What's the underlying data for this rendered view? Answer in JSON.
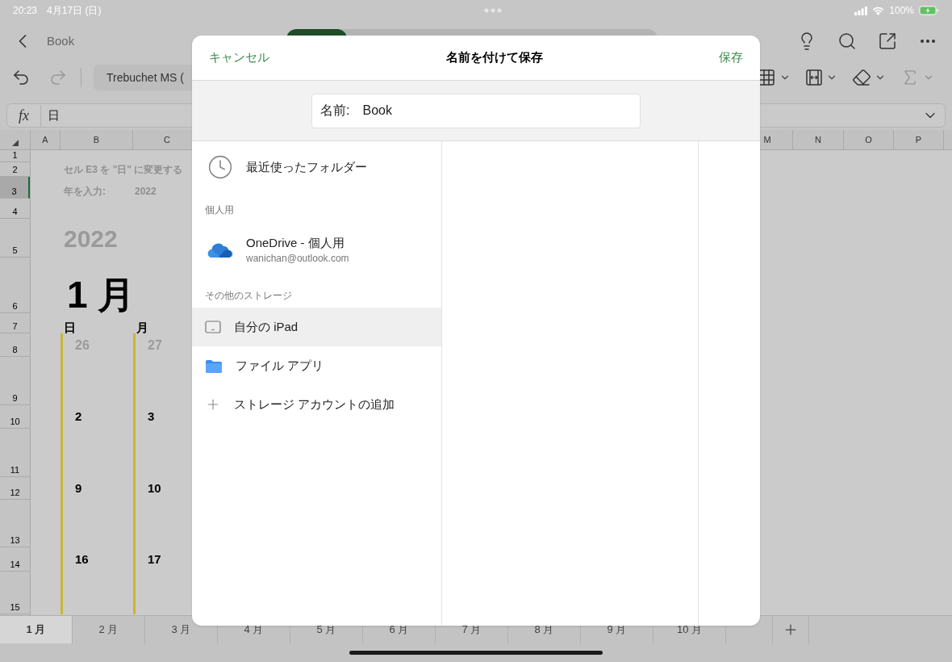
{
  "status_bar": {
    "time": "20:23",
    "date": "4月17日 (日)",
    "battery": "100%"
  },
  "title_bar": {
    "title": "Book"
  },
  "toolbar": {
    "font": "Trebuchet MS ("
  },
  "formula_bar": {
    "function_label": "fx",
    "value": "日"
  },
  "sheet": {
    "columns_left": [
      "A",
      "B",
      "C"
    ],
    "columns_right": [
      "M",
      "N",
      "O",
      "P"
    ],
    "rows": [
      {
        "number": "1",
        "selected": false,
        "cells": []
      },
      {
        "number": "2",
        "selected": false,
        "cells": [
          {
            "text": "セル E3 を \"日\" に変更する",
            "kind": "note"
          }
        ]
      },
      {
        "number": "3",
        "selected": true,
        "cells": [
          {
            "text": "年を入力:",
            "kind": "note"
          },
          {
            "text": "2022",
            "kind": "input"
          }
        ]
      },
      {
        "number": "4",
        "selected": false,
        "cells": []
      },
      {
        "number": "5",
        "selected": false,
        "cells": [
          {
            "text": "2022",
            "kind": "year"
          }
        ]
      },
      {
        "number": "6",
        "selected": false,
        "cells": [
          {
            "text": "1 月",
            "kind": "month"
          }
        ]
      },
      {
        "number": "7",
        "selected": false,
        "cells": [
          {
            "text": "日",
            "kind": "weekday"
          },
          {
            "text": "月",
            "kind": "weekday"
          }
        ]
      },
      {
        "number": "8",
        "selected": false,
        "cells": [
          {
            "text": "26",
            "kind": "other_month"
          },
          {
            "text": "27",
            "kind": "other_month"
          }
        ]
      },
      {
        "number": "9",
        "selected": false,
        "cells": []
      },
      {
        "number": "10",
        "selected": false,
        "cells": [
          {
            "text": "2",
            "kind": "date"
          },
          {
            "text": "3",
            "kind": "date"
          }
        ]
      },
      {
        "number": "11",
        "selected": false,
        "cells": []
      },
      {
        "number": "12",
        "selected": false,
        "cells": [
          {
            "text": "9",
            "kind": "date"
          },
          {
            "text": "10",
            "kind": "date"
          }
        ]
      },
      {
        "number": "13",
        "selected": false,
        "cells": []
      },
      {
        "number": "14",
        "selected": false,
        "cells": [
          {
            "text": "16",
            "kind": "date"
          },
          {
            "text": "17",
            "kind": "date"
          }
        ]
      },
      {
        "number": "15",
        "selected": false,
        "cells": []
      }
    ]
  },
  "sheet_tabs": [
    {
      "label": "1 月",
      "selected": true
    },
    {
      "label": "2 月",
      "selected": false
    },
    {
      "label": "3 月",
      "selected": false
    },
    {
      "label": "4 月",
      "selected": false
    },
    {
      "label": "5 月",
      "selected": false
    },
    {
      "label": "6 月",
      "selected": false
    },
    {
      "label": "7 月",
      "selected": false
    },
    {
      "label": "8 月",
      "selected": false
    },
    {
      "label": "9 月",
      "selected": false
    },
    {
      "label": "10 月",
      "selected": false
    }
  ],
  "dialog": {
    "cancel": "キャンセル",
    "title": "名前を付けて保存",
    "save": "保存",
    "name_label": "名前:",
    "name_value": "Book",
    "items": [
      {
        "kind": "recent",
        "label": "最近使ったフォルダー",
        "selected": false
      },
      {
        "kind": "section",
        "label": "個人用"
      },
      {
        "kind": "onedrive",
        "label": "OneDrive - 個人用",
        "sub": "wanichan@outlook.com",
        "selected": false
      },
      {
        "kind": "section",
        "label": "その他のストレージ"
      },
      {
        "kind": "device",
        "label": "自分の iPad",
        "selected": true
      },
      {
        "kind": "files",
        "label": "ファイル アプリ",
        "selected": false
      },
      {
        "kind": "add",
        "label": "ストレージ アカウントの追加"
      }
    ]
  }
}
